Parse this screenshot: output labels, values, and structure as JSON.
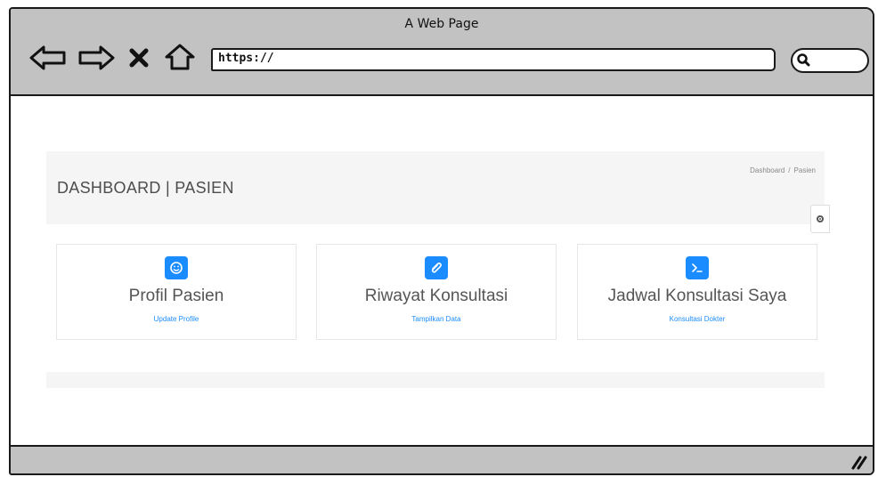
{
  "browser": {
    "window_title": "A Web Page",
    "url": "https://",
    "search_icon": "search-icon",
    "nav_icons": [
      "back-arrow-icon",
      "forward-arrow-icon",
      "stop-icon",
      "home-icon"
    ]
  },
  "header": {
    "title": "DASHBOARD | PASIEN",
    "breadcrumb": {
      "home": "Dashboard",
      "separator": "/",
      "current": "Pasien"
    }
  },
  "cards": [
    {
      "icon": "smiley-icon",
      "title": "Profil Pasien",
      "link": "Update Profile"
    },
    {
      "icon": "paperclip-icon",
      "title": "Riwayat Konsultasi",
      "link": "Tampilkan Data"
    },
    {
      "icon": "terminal-icon",
      "title": "Jadwal Konsultasi Saya",
      "link": "Konsultasi Dokter"
    }
  ],
  "colors": {
    "accent": "#1a8cff",
    "chrome": "#c2c2c2",
    "panel": "#f5f5f5"
  }
}
